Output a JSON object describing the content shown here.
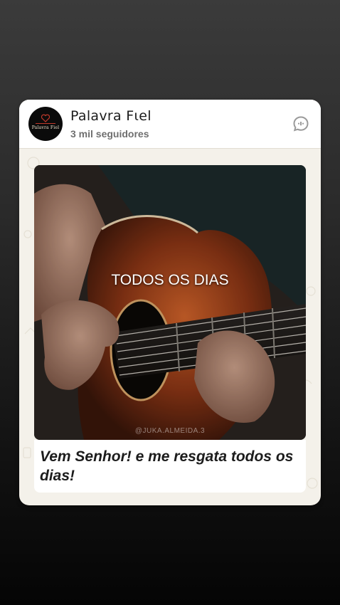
{
  "post": {
    "channel_name": "Palavra Fιel",
    "followers": "3 mil seguidores",
    "avatar_logo_text": "Palavra Fiel",
    "media": {
      "overlay_text": "TODOS OS DIAS",
      "watermark": "@JUKA.ALMEIDA.3"
    },
    "caption": "Vem Senhor! e me resgata todos os dias!"
  },
  "icons": {
    "chat": "chat-bubble-icon",
    "logo": "heart-book-logo"
  },
  "colors": {
    "card_bg": "#f4f1ea",
    "text": "#1c1c1c",
    "secondary_text": "#6f6f6f",
    "icon_gray": "#9a9a9a"
  }
}
